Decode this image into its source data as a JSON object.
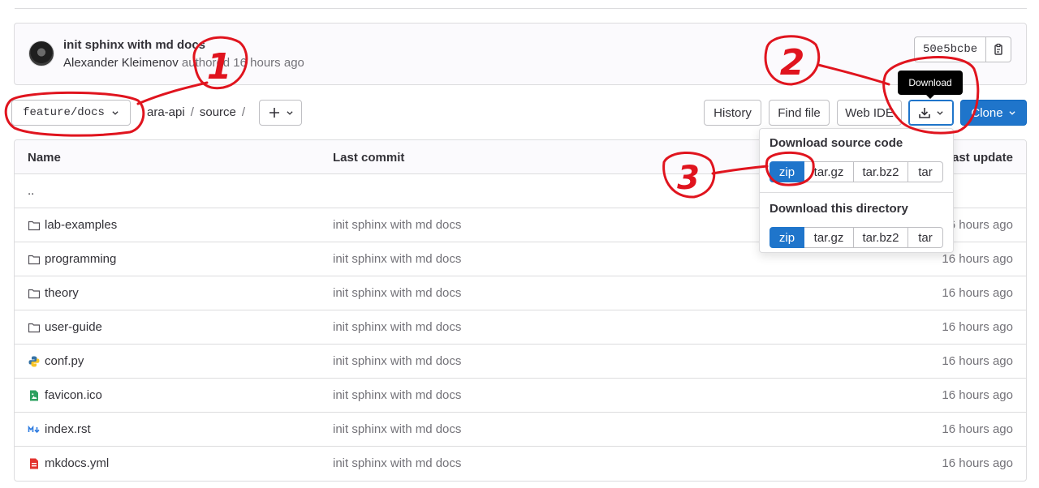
{
  "commit": {
    "title": "init sphinx with md docs",
    "author": "Alexander Kleimenov",
    "authored_text": "authored 16 hours ago",
    "sha": "50e5bcbe"
  },
  "nav": {
    "branch": "feature/docs",
    "breadcrumbs": [
      "ara-api",
      "source"
    ],
    "buttons": {
      "history": "History",
      "find_file": "Find file",
      "web_ide": "Web IDE",
      "clone": "Clone"
    },
    "tooltip": "Download"
  },
  "download_menu": {
    "source_heading": "Download source code",
    "directory_heading": "Download this directory",
    "formats": [
      "zip",
      "tar.gz",
      "tar.bz2",
      "tar"
    ]
  },
  "table": {
    "headers": {
      "name": "Name",
      "last_commit": "Last commit",
      "last_update": "Last update"
    },
    "parent": "..",
    "rows": [
      {
        "icon": "folder-icon",
        "name": "lab-examples",
        "commit": "init sphinx with md docs",
        "updated": "16 hours ago"
      },
      {
        "icon": "folder-icon",
        "name": "programming",
        "commit": "init sphinx with md docs",
        "updated": "16 hours ago"
      },
      {
        "icon": "folder-icon",
        "name": "theory",
        "commit": "init sphinx with md docs",
        "updated": "16 hours ago"
      },
      {
        "icon": "folder-icon",
        "name": "user-guide",
        "commit": "init sphinx with md docs",
        "updated": "16 hours ago"
      },
      {
        "icon": "python-file-icon",
        "name": "conf.py",
        "commit": "init sphinx with md docs",
        "updated": "16 hours ago"
      },
      {
        "icon": "image-file-icon",
        "name": "favicon.ico",
        "commit": "init sphinx with md docs",
        "updated": "16 hours ago"
      },
      {
        "icon": "markdown-file-icon",
        "name": "index.rst",
        "commit": "init sphinx with md docs",
        "updated": "16 hours ago"
      },
      {
        "icon": "yaml-file-icon",
        "name": "mkdocs.yml",
        "commit": "init sphinx with md docs",
        "updated": "16 hours ago"
      }
    ]
  },
  "annotations": [
    "1",
    "2",
    "3"
  ],
  "colors": {
    "primary": "#1f75cb",
    "annotation": "#e0141e",
    "border": "#dcdcde",
    "muted": "#737278"
  }
}
